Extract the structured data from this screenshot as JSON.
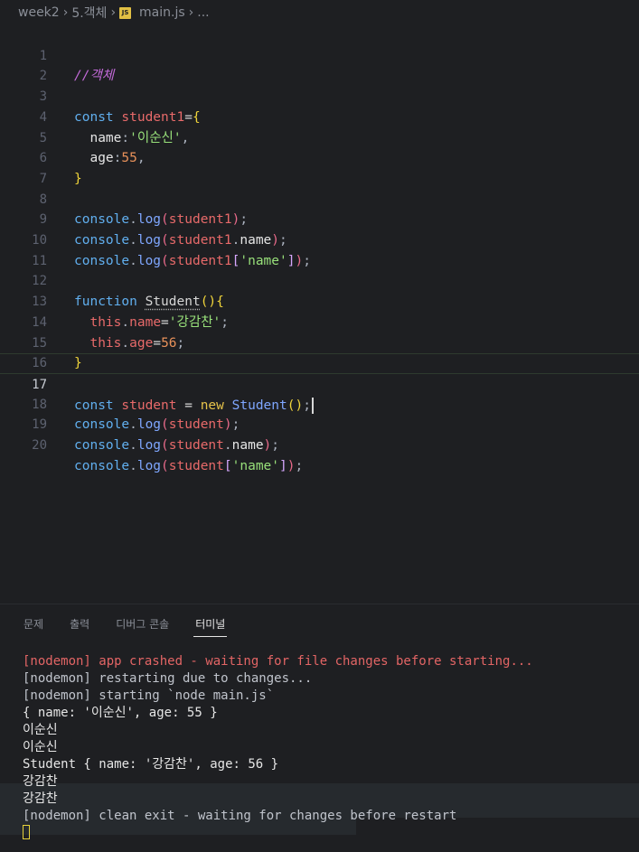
{
  "breadcrumb": {
    "parts": [
      "week2",
      "5.객체",
      "main.js",
      "..."
    ],
    "file_icon": "JS"
  },
  "editor": {
    "active_line": 17,
    "lines": [
      {
        "n": "1"
      },
      {
        "n": "2"
      },
      {
        "n": "3"
      },
      {
        "n": "4"
      },
      {
        "n": "5"
      },
      {
        "n": "6"
      },
      {
        "n": "7"
      },
      {
        "n": "8"
      },
      {
        "n": "9"
      },
      {
        "n": "10"
      },
      {
        "n": "11"
      },
      {
        "n": "12"
      },
      {
        "n": "13"
      },
      {
        "n": "14"
      },
      {
        "n": "15"
      },
      {
        "n": "16"
      },
      {
        "n": "17"
      },
      {
        "n": "18"
      },
      {
        "n": "19"
      },
      {
        "n": "20"
      }
    ],
    "code": {
      "l1_comment": "//객체",
      "l3_const": "const",
      "l3_var": "student1",
      "l3_eq": "=",
      "l3_brace": "{",
      "l4_prop": "name",
      "l4_colon": ":",
      "l4_str": "'이순신'",
      "l4_comma": ",",
      "l5_prop": "age",
      "l5_colon": ":",
      "l5_num": "55",
      "l5_comma": ",",
      "l6_brace": "}",
      "console": "console",
      "dot": ".",
      "log": "log",
      "paren_open": "(",
      "paren_close": ")",
      "semi": ";",
      "student1": "student1",
      "name_prop": "name",
      "brack_open": "[",
      "brack_close": "]",
      "name_str": "'name'",
      "l12_function": "function",
      "l12_cls": "Student",
      "l12_parens": "()",
      "l12_brace": "{",
      "this": "this",
      "l13_prop": "name",
      "l13_eq": "=",
      "l13_str": "'강감찬'",
      "l14_prop": "age",
      "l14_eq": "=",
      "l14_num": "56",
      "l15_brace": "}",
      "l17_var": "student",
      "l17_eq": " = ",
      "l17_new": "new",
      "l17_cls": "Student",
      "l17_parens": "()",
      "student": "student"
    }
  },
  "panel": {
    "tabs": [
      "문제",
      "출력",
      "디버그 콘솔",
      "터미널"
    ],
    "active_tab": "터미널"
  },
  "terminal": {
    "lines": [
      "[nodemon] app crashed - waiting for file changes before starting...",
      "[nodemon] restarting due to changes...",
      "[nodemon] starting `node main.js`",
      "{ name: '이순신', age: 55 }",
      "이순신",
      "이순신",
      "Student { name: '강감찬', age: 56 }",
      "강감찬",
      "강감찬",
      "[nodemon] clean exit - waiting for changes before restart"
    ]
  },
  "colors": {
    "background": "#1e1f22",
    "error_text": "#e36565",
    "accent_cursor": "#e6d23a"
  }
}
